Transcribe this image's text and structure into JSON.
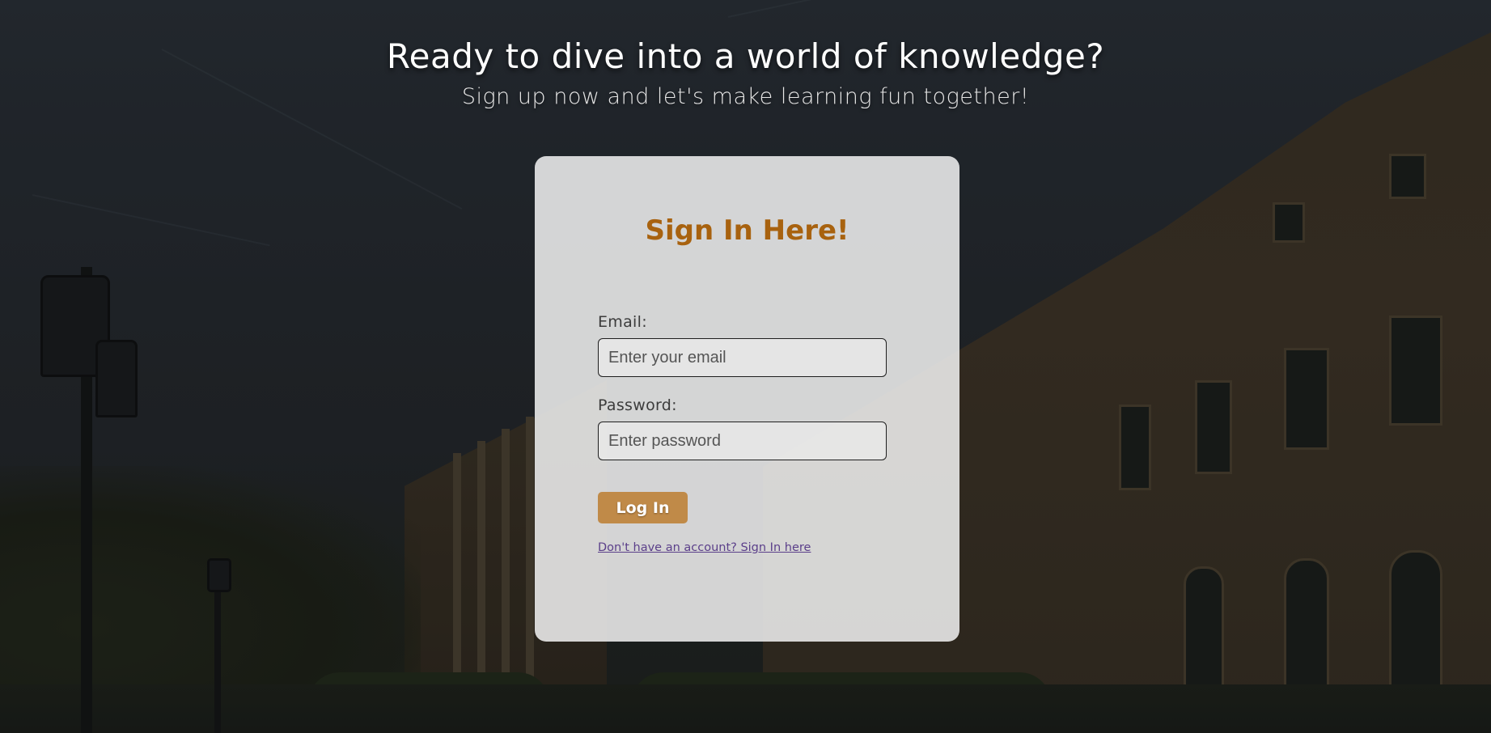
{
  "header": {
    "headline": "Ready to dive into a world of knowledge?",
    "subline": "Sign up now and let's make learning fun together!"
  },
  "card": {
    "title": "Sign In Here!",
    "email": {
      "label": "Email:",
      "placeholder": "Enter your email",
      "value": ""
    },
    "password": {
      "label": "Password:",
      "placeholder": "Enter password",
      "value": ""
    },
    "login_button": "Log In",
    "signup_link": "Don't have an account? Sign In here"
  },
  "colors": {
    "title": "#a8620f",
    "button": "#c08a48",
    "link": "#5b3f8a",
    "card_background": "#eeeeee"
  },
  "icons": []
}
